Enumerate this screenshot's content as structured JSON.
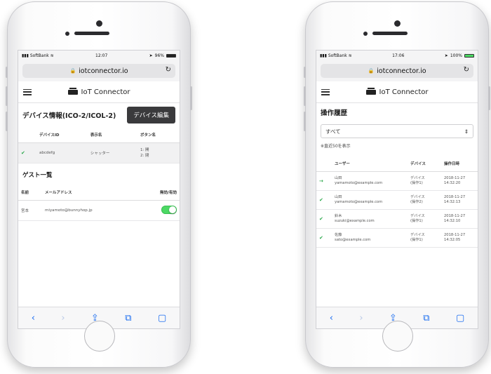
{
  "left": {
    "status": {
      "carrier": "SoftBank",
      "time": "12:07",
      "battery": "96%"
    },
    "url": "iotconnector.io",
    "brand": "IoT Connector",
    "page_title": "デバイス情報(ICO-2/ICOL-2)",
    "edit_button": "デバイス編集",
    "device_table": {
      "headers": [
        "",
        "デバイスID",
        "表示名",
        "ボタン名"
      ],
      "rows": [
        {
          "device_id": "abcdefg",
          "display_name": "シャッター",
          "button_names": "1: 開\n2: 閉"
        }
      ]
    },
    "guest_title": "ゲスト一覧",
    "guest_table": {
      "headers": [
        "名前",
        "メールアドレス",
        "無効/有効"
      ],
      "rows": [
        {
          "name": "宮本",
          "email": "miyamoto@bunnyhop.jp"
        }
      ]
    }
  },
  "right": {
    "status": {
      "carrier": "SoftBank",
      "time": "17:06",
      "battery": "100%"
    },
    "url": "iotconnector.io",
    "brand": "IoT Connector",
    "page_title": "操作履歴",
    "filter_value": "すべて",
    "note": "※直近50を表示",
    "history_table": {
      "headers": [
        "",
        "ユーザー",
        "デバイス",
        "操作日時"
      ],
      "rows": [
        {
          "mark": "→",
          "user": "山田\nyamamoto@example.com",
          "device": "デバイス\n(操作1)",
          "datetime": "2018-11-27\n14:32:20"
        },
        {
          "mark": "✔",
          "user": "山田\nyamamoto@example.com",
          "device": "デバイス\n(操作2)",
          "datetime": "2018-11-27\n14:32:13"
        },
        {
          "mark": "✔",
          "user": "鈴木\nsuzuki@example.com",
          "device": "デバイス\n(操作1)",
          "datetime": "2018-11-27\n14:32:10"
        },
        {
          "mark": "✔",
          "user": "佐藤\nsato@example.com",
          "device": "デバイス\n(操作1)",
          "datetime": "2018-11-27\n14:32:05"
        }
      ]
    }
  },
  "toolbar_icons": [
    "back-icon",
    "forward-icon",
    "share-icon",
    "bookmarks-icon",
    "tabs-icon"
  ],
  "colors": {
    "accent_green": "#4cd964",
    "check_green": "#2aa84a",
    "button_dark": "#3a3a3c",
    "ios_blue": "#1a6cf0"
  }
}
